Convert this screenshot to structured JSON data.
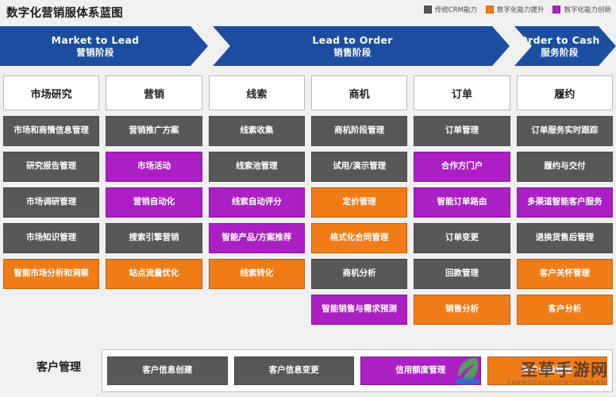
{
  "header": {
    "title": "数字化营销服体系蓝图",
    "legend": [
      {
        "label": "传统CRM能力",
        "color": "#585858",
        "key": "legacy-crm"
      },
      {
        "label": "数字化能力提升",
        "color": "#f07c18",
        "key": "digital-uplift"
      },
      {
        "label": "数字化能力创新",
        "color": "#ab1fc4",
        "key": "digital-innovation"
      }
    ]
  },
  "stages": [
    {
      "en": "Market to Lead",
      "zh": "营销阶段"
    },
    {
      "en": "Lead to Order",
      "zh": "销售阶段"
    },
    {
      "en": "Order to Cash",
      "zh": "服务阶段"
    }
  ],
  "columns": [
    {
      "head": "市场研究",
      "cards": [
        {
          "label": "市场和商情信息管理",
          "type": "gray"
        },
        {
          "label": "研究报告管理",
          "type": "gray"
        },
        {
          "label": "市场调研管理",
          "type": "gray"
        },
        {
          "label": "市场知识管理",
          "type": "gray"
        },
        {
          "label": "智能市场分析和洞察",
          "type": "orange"
        },
        {
          "label": "",
          "type": "empty"
        }
      ]
    },
    {
      "head": "营销",
      "cards": [
        {
          "label": "营销推广方案",
          "type": "gray"
        },
        {
          "label": "市场活动",
          "type": "purple"
        },
        {
          "label": "营销自动化",
          "type": "purple"
        },
        {
          "label": "搜索引擎营销",
          "type": "gray"
        },
        {
          "label": "站点流量优化",
          "type": "orange"
        },
        {
          "label": "",
          "type": "empty"
        }
      ]
    },
    {
      "head": "线索",
      "cards": [
        {
          "label": "线索收集",
          "type": "gray"
        },
        {
          "label": "线索池管理",
          "type": "gray"
        },
        {
          "label": "线索自动评分",
          "type": "purple"
        },
        {
          "label": "智能产品/方案推荐",
          "type": "purple"
        },
        {
          "label": "线索转化",
          "type": "orange"
        },
        {
          "label": "",
          "type": "empty"
        }
      ]
    },
    {
      "head": "商机",
      "cards": [
        {
          "label": "商机阶段管理",
          "type": "gray"
        },
        {
          "label": "试用/演示管理",
          "type": "gray"
        },
        {
          "label": "定价管理",
          "type": "orange"
        },
        {
          "label": "格式化合同管理",
          "type": "orange"
        },
        {
          "label": "商机分析",
          "type": "gray"
        },
        {
          "label": "智能销售与需求预测",
          "type": "purple"
        }
      ]
    },
    {
      "head": "订单",
      "cards": [
        {
          "label": "订单管理",
          "type": "gray"
        },
        {
          "label": "合作方门户",
          "type": "purple"
        },
        {
          "label": "智能订单路由",
          "type": "purple"
        },
        {
          "label": "订单变更",
          "type": "gray"
        },
        {
          "label": "回款管理",
          "type": "gray"
        },
        {
          "label": "销售分析",
          "type": "orange"
        }
      ]
    },
    {
      "head": "履约",
      "cards": [
        {
          "label": "订单服务实时跟踪",
          "type": "gray"
        },
        {
          "label": "履约与交付",
          "type": "gray"
        },
        {
          "label": "多渠道智能客户服务",
          "type": "purple"
        },
        {
          "label": "退换货售后管理",
          "type": "gray"
        },
        {
          "label": "客户关怀管理",
          "type": "orange"
        },
        {
          "label": "客户分析",
          "type": "orange"
        }
      ]
    }
  ],
  "bottom": {
    "label": "客户管理",
    "cards": [
      {
        "label": "客户信息创建",
        "type": "gray"
      },
      {
        "label": "客户信息变更",
        "type": "gray"
      },
      {
        "label": "信用额度管理",
        "type": "purple"
      },
      {
        "label": "客户分级管理",
        "type": "orange"
      }
    ]
  },
  "watermark": {
    "text": "圣草手游网",
    "sub": "SHENGCAOSHOUYOUWANG"
  }
}
